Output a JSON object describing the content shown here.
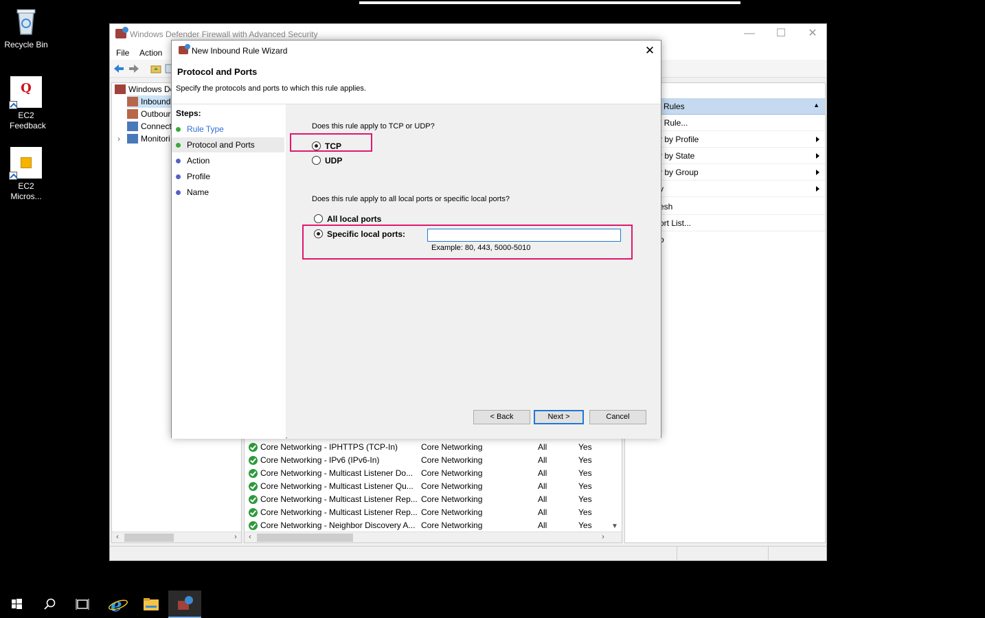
{
  "desktop": {
    "icons": [
      {
        "label": "Recycle Bin",
        "icon": "recycle-bin-icon"
      },
      {
        "label": "EC2 Feedback",
        "icon": "ec2-feedback-icon"
      },
      {
        "label": "EC2 Micros...",
        "icon": "ec2-microsoft-icon"
      }
    ]
  },
  "main_window": {
    "title": "Windows Defender Firewall with Advanced Security",
    "menu": {
      "file": "File",
      "action": "Action"
    },
    "tree": {
      "root": "Windows De",
      "items": [
        "Inbound",
        "Outbour",
        "Connect",
        "Monitori"
      ]
    },
    "rules": [
      {
        "name": "Core Networking - IPHTTPS (TCP-In)",
        "group": "Core Networking",
        "profile": "All",
        "enabled": "Yes"
      },
      {
        "name": "Core Networking - IPv6 (IPv6-In)",
        "group": "Core Networking",
        "profile": "All",
        "enabled": "Yes"
      },
      {
        "name": "Core Networking - Multicast Listener Do...",
        "group": "Core Networking",
        "profile": "All",
        "enabled": "Yes"
      },
      {
        "name": "Core Networking - Multicast Listener Qu...",
        "group": "Core Networking",
        "profile": "All",
        "enabled": "Yes"
      },
      {
        "name": "Core Networking - Multicast Listener Rep...",
        "group": "Core Networking",
        "profile": "All",
        "enabled": "Yes"
      },
      {
        "name": "Core Networking - Multicast Listener Rep...",
        "group": "Core Networking",
        "profile": "All",
        "enabled": "Yes"
      },
      {
        "name": "Core Networking - Neighbor Discovery A...",
        "group": "Core Networking",
        "profile": "All",
        "enabled": "Yes"
      }
    ],
    "actions": {
      "header": "Rules",
      "items": [
        {
          "label": "/ Rule...",
          "submenu": false
        },
        {
          "label": "r by Profile",
          "submenu": true
        },
        {
          "label": "r by State",
          "submenu": true
        },
        {
          "label": "r by Group",
          "submenu": true
        },
        {
          "label": "v",
          "submenu": true
        },
        {
          "label": "esh",
          "submenu": false
        },
        {
          "label": "ort List...",
          "submenu": false
        },
        {
          "label": "o",
          "submenu": false
        }
      ]
    }
  },
  "wizard": {
    "title": "New Inbound Rule Wizard",
    "close": "✕",
    "heading": "Protocol and Ports",
    "subheading": "Specify the protocols and ports to which this rule applies.",
    "steps_label": "Steps:",
    "steps": [
      "Rule Type",
      "Protocol and Ports",
      "Action",
      "Profile",
      "Name"
    ],
    "protocol_question": "Does this rule apply to TCP or UDP?",
    "tcp": "TCP",
    "udp": "UDP",
    "ports_question": "Does this rule apply to all local ports or specific local ports?",
    "all_ports": "All local ports",
    "specific_ports": "Specific local ports:",
    "ports_value": "",
    "example": "Example: 80, 443, 5000-5010",
    "back": "< Back",
    "next": "Next >",
    "cancel": "Cancel"
  },
  "colors": {
    "highlight": "#e0176e",
    "accent": "#1e78d2",
    "step_current": "#2f6fd1",
    "step_done": "#3aa83a"
  }
}
